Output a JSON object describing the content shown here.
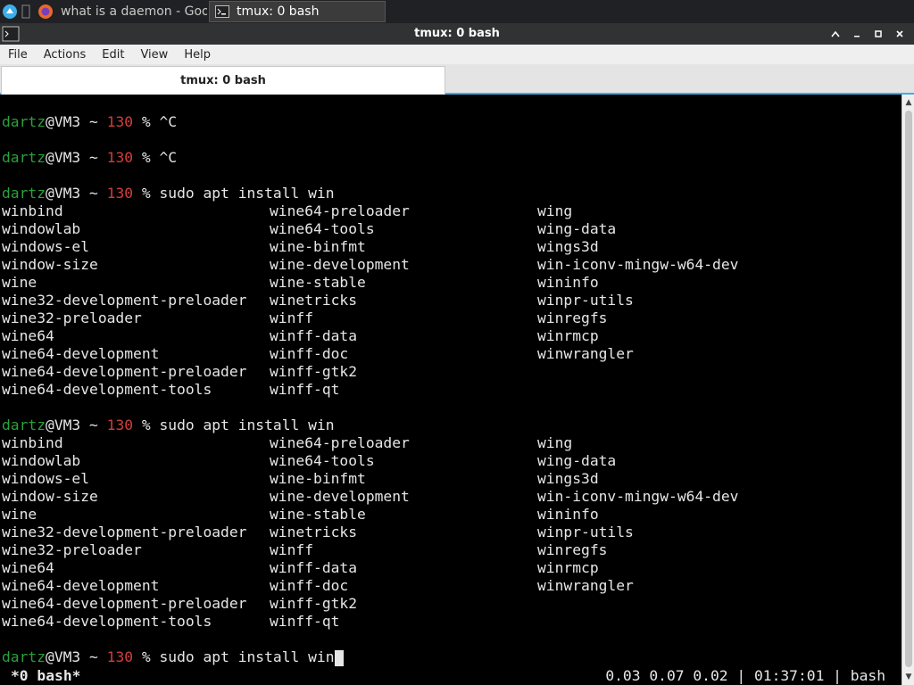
{
  "taskbar": {
    "tasks": [
      {
        "label": "what is a daemon - Goo...",
        "active": false
      },
      {
        "label": "tmux: 0 bash",
        "active": true
      }
    ]
  },
  "window": {
    "title": "tmux: 0 bash",
    "controls": [
      "minimize",
      "restore",
      "maximize",
      "close"
    ]
  },
  "menu": [
    "File",
    "Actions",
    "Edit",
    "View",
    "Help"
  ],
  "tab": {
    "label": "tmux: 0 bash"
  },
  "terminal": {
    "prompt": {
      "user": "dartz",
      "host": "VM3",
      "cwd": "~",
      "code": "130",
      "symbol": "%"
    },
    "commands": [
      "^C",
      "^C",
      "sudo apt install win",
      "sudo apt install win",
      "sudo apt install win"
    ],
    "completions": [
      [
        "winbind",
        "wine64-preloader",
        "wing"
      ],
      [
        "windowlab",
        "wine64-tools",
        "wing-data"
      ],
      [
        "windows-el",
        "wine-binfmt",
        "wings3d"
      ],
      [
        "window-size",
        "wine-development",
        "win-iconv-mingw-w64-dev"
      ],
      [
        "wine",
        "wine-stable",
        "wininfo"
      ],
      [
        "wine32-development-preloader",
        "winetricks",
        "winpr-utils"
      ],
      [
        "wine32-preloader",
        "winff",
        "winregfs"
      ],
      [
        "wine64",
        "winff-data",
        "winrmcp"
      ],
      [
        "wine64-development",
        "winff-doc",
        "winwrangler"
      ],
      [
        "wine64-development-preloader",
        "winff-gtk2",
        ""
      ],
      [
        "wine64-development-tools",
        "winff-qt",
        ""
      ]
    ],
    "status_left": "*0 bash*",
    "status_right": "0.03 0.07 0.02 | 01:37:01 | bash"
  },
  "colors": {
    "prompt_user": "#2aa13a",
    "prompt_code": "#d23d3d",
    "accent": "#3daee9"
  }
}
